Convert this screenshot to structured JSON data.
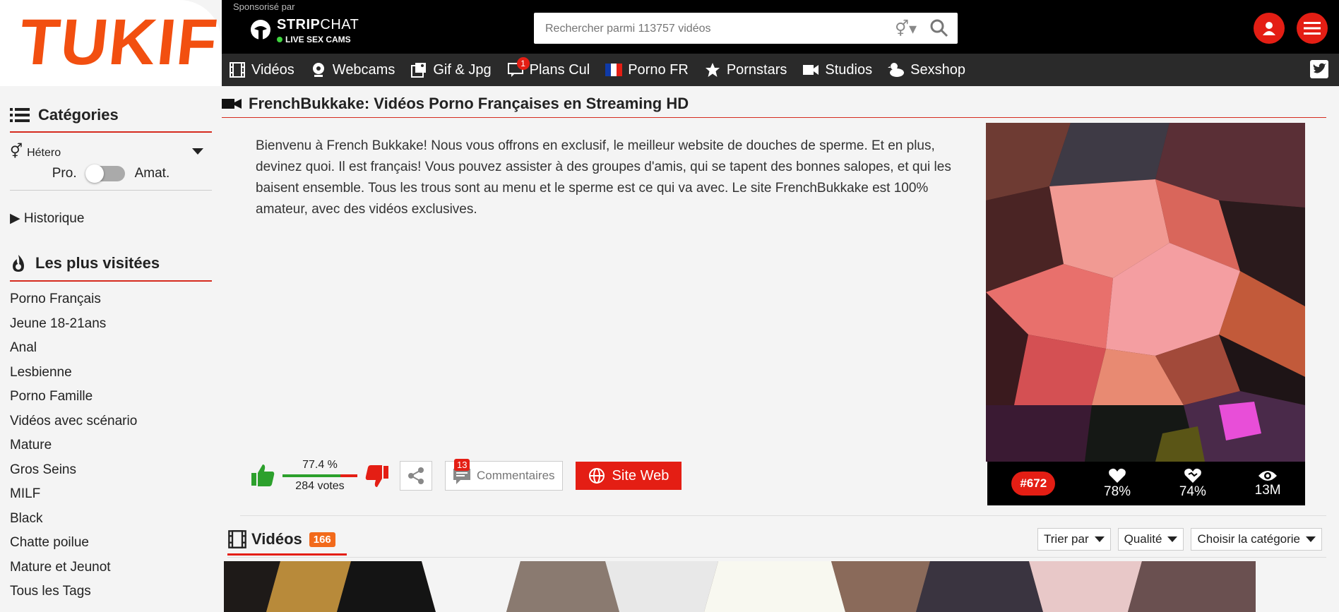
{
  "brand": {
    "logo_text": "TUKIF"
  },
  "topbar": {
    "sponsor_label": "Sponsorisé par",
    "sponsor_name_bold": "STRIP",
    "sponsor_name_rest": "CHAT",
    "sponsor_tagline": "LIVE SEX CAMS",
    "search_placeholder": "Rechercher parmi 113757 vidéos"
  },
  "nav": {
    "items": [
      {
        "label": "Vidéos",
        "icon": "film-icon"
      },
      {
        "label": "Webcams",
        "icon": "webcam-icon"
      },
      {
        "label": "Gif & Jpg",
        "icon": "image-icon"
      },
      {
        "label": "Plans Cul",
        "icon": "chat-icon",
        "badge": "1"
      },
      {
        "label": "Porno FR",
        "icon": "french-flag-icon"
      },
      {
        "label": "Pornstars",
        "icon": "star-icon"
      },
      {
        "label": "Studios",
        "icon": "camera-icon"
      },
      {
        "label": "Sexshop",
        "icon": "duck-icon"
      }
    ]
  },
  "sidebar": {
    "categories_title": "Catégories",
    "gender_value": "Hétero",
    "toggle_left": "Pro.",
    "toggle_right": "Amat.",
    "history_label": "▶ Historique",
    "visits_title": "Les plus visitées",
    "categories": [
      "Porno Français",
      "Jeune 18-21ans",
      "Anal",
      "Lesbienne",
      "Porno Famille",
      "Vidéos avec scénario",
      "Mature",
      "Gros Seins",
      "MILF",
      "Black",
      "Chatte poilue",
      "Mature et Jeunot",
      "Tous les Tags"
    ]
  },
  "studio": {
    "title": "FrenchBukkake: Vidéos Porno Françaises en Streaming HD",
    "description": "Bienvenu à French Bukkake! Nous vous offrons en exclusif, le meilleur website de douches de sperme. Et en plus, devinez quoi. Il est français! Vous pouvez assister à des groupes d'amis, qui se tapent des bonnes salopes, et qui les baisent ensemble. Tous les trous sont au menu et le sperme est ce qui va avec. Le site FrenchBukkake est 100% amateur, avec des vidéos exclusives.",
    "rating_percent": "77.4 %",
    "rating_fraction": 0.774,
    "votes": "284 votes",
    "comments_count": "13",
    "comments_label": "Commentaires",
    "website_label": "Site Web",
    "stats": {
      "rank": "#672",
      "likes": "78%",
      "favs": "74%",
      "views": "13M"
    }
  },
  "videos": {
    "title": "Vidéos",
    "count": "166",
    "filters": [
      "Trier par",
      "Qualité",
      "Choisir la catégorie"
    ]
  },
  "colors": {
    "accent": "#e41e14",
    "brand": "#f24f10",
    "count_badge": "#f26a1b"
  }
}
